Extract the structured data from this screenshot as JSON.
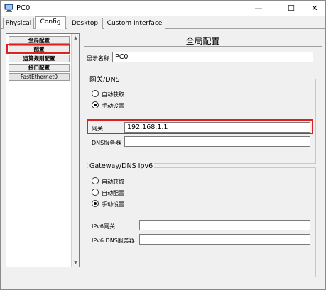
{
  "window": {
    "title": "PC0",
    "minimize": "—",
    "maximize": "☐",
    "close": "✕"
  },
  "tabs": [
    {
      "label": "Physical",
      "active": false
    },
    {
      "label": "Config",
      "active": true
    },
    {
      "label": "Desktop",
      "active": false
    },
    {
      "label": "Custom Interface",
      "active": false
    }
  ],
  "sidebar": {
    "items": [
      {
        "label": "全局配置"
      },
      {
        "label": "配置"
      },
      {
        "label": "运算规则配置"
      },
      {
        "label": "接口配置"
      },
      {
        "label": "FastEthernet0"
      }
    ]
  },
  "main": {
    "title": "全局配置",
    "display_name_label": "显示名称",
    "display_name_value": "PC0",
    "ipv4_group": {
      "title": "网关/DNS",
      "auto_label": "自动获取",
      "manual_label": "手动设置",
      "selected": "manual",
      "gateway_label": "网关",
      "gateway_value": "192.168.1.1",
      "dns_label": "DNS服务器",
      "dns_value": ""
    },
    "ipv6_group": {
      "title": "Gateway/DNS Ipv6",
      "auto_label": "自动获取",
      "autoconfig_label": "自动配置",
      "manual_label": "手动设置",
      "selected": "manual",
      "gateway_label": "IPv6网关",
      "gateway_value": "",
      "dns_label": "IPv6 DNS服务器",
      "dns_value": ""
    }
  },
  "colors": {
    "highlight": "#e02020",
    "panel_bg": "#f0f0f0"
  }
}
